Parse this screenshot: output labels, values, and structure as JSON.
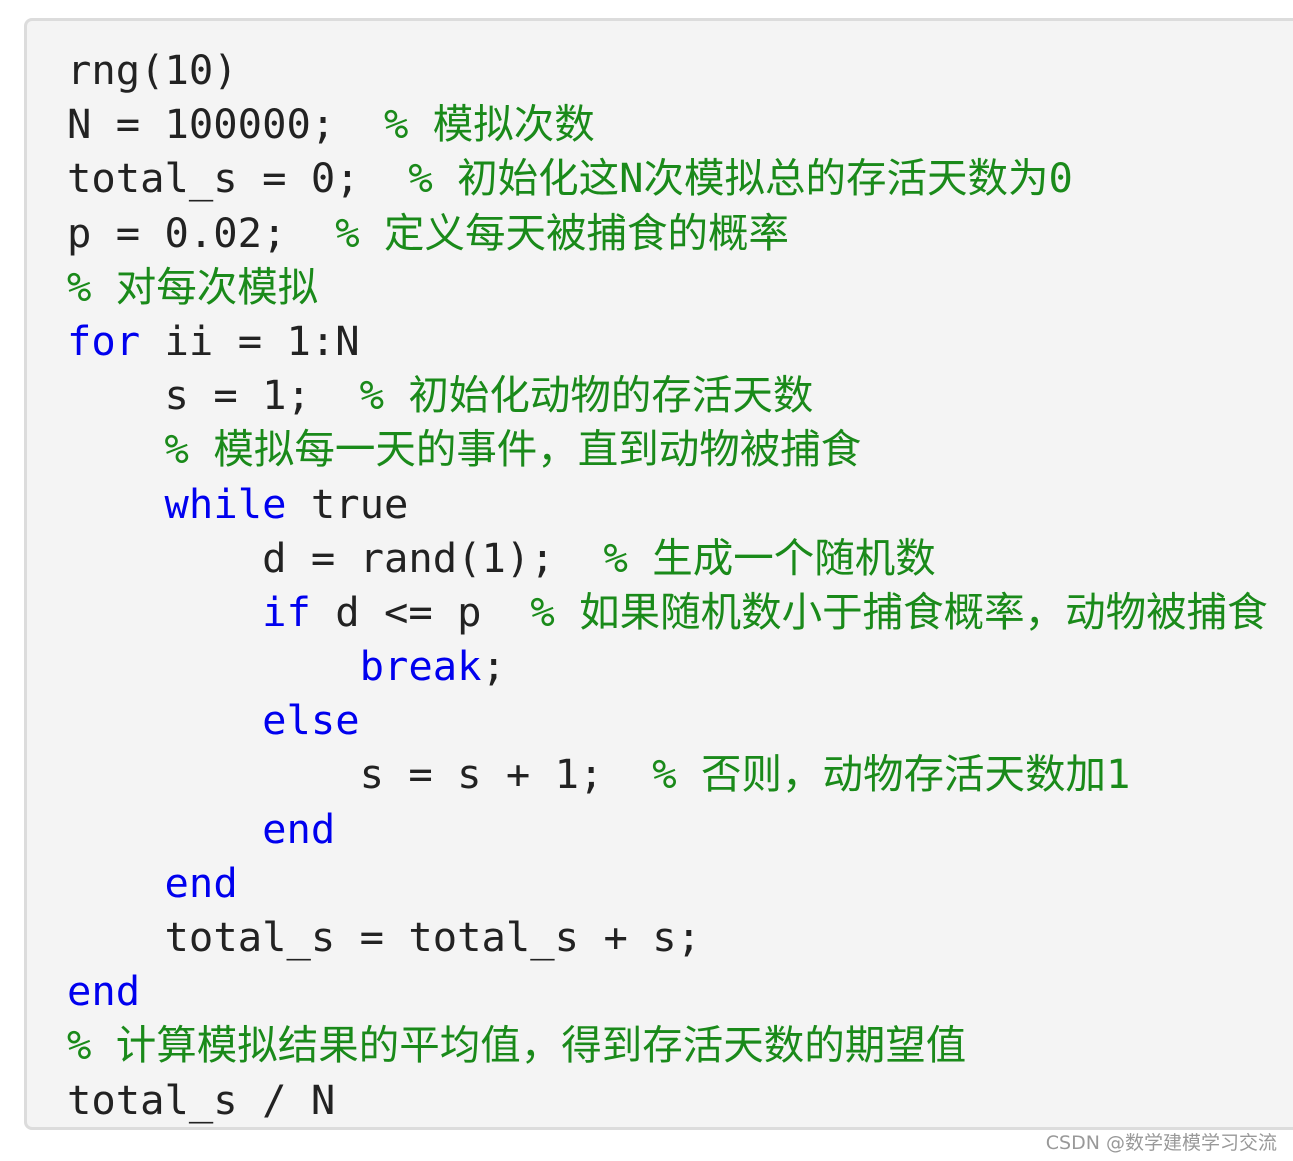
{
  "code_lines": [
    {
      "indent": "",
      "parts": [
        {
          "t": "code",
          "v": "rng(10)"
        }
      ]
    },
    {
      "indent": "",
      "parts": [
        {
          "t": "code",
          "v": "N = 100000;  "
        },
        {
          "t": "comment",
          "v": "% 模拟次数"
        }
      ]
    },
    {
      "indent": "",
      "parts": [
        {
          "t": "code",
          "v": "total_s = 0;  "
        },
        {
          "t": "comment",
          "v": "% 初始化这N次模拟总的存活天数为0"
        }
      ]
    },
    {
      "indent": "",
      "parts": [
        {
          "t": "code",
          "v": "p = 0.02;  "
        },
        {
          "t": "comment",
          "v": "% 定义每天被捕食的概率"
        }
      ]
    },
    {
      "indent": "",
      "parts": [
        {
          "t": "comment",
          "v": "% 对每次模拟"
        }
      ]
    },
    {
      "indent": "",
      "parts": [
        {
          "t": "keyword",
          "v": "for"
        },
        {
          "t": "code",
          "v": " ii = 1:N"
        }
      ]
    },
    {
      "indent": "    ",
      "parts": [
        {
          "t": "code",
          "v": "s = 1;  "
        },
        {
          "t": "comment",
          "v": "% 初始化动物的存活天数"
        }
      ]
    },
    {
      "indent": "    ",
      "parts": [
        {
          "t": "comment",
          "v": "% 模拟每一天的事件，直到动物被捕食"
        }
      ]
    },
    {
      "indent": "    ",
      "parts": [
        {
          "t": "keyword",
          "v": "while"
        },
        {
          "t": "code",
          "v": " true"
        }
      ]
    },
    {
      "indent": "        ",
      "parts": [
        {
          "t": "code",
          "v": "d = rand(1);  "
        },
        {
          "t": "comment",
          "v": "% 生成一个随机数"
        }
      ]
    },
    {
      "indent": "        ",
      "parts": [
        {
          "t": "keyword",
          "v": "if"
        },
        {
          "t": "code",
          "v": " d <= p  "
        },
        {
          "t": "comment",
          "v": "% 如果随机数小于捕食概率，动物被捕食"
        }
      ]
    },
    {
      "indent": "            ",
      "parts": [
        {
          "t": "keyword",
          "v": "break"
        },
        {
          "t": "code",
          "v": ";"
        }
      ]
    },
    {
      "indent": "        ",
      "parts": [
        {
          "t": "keyword",
          "v": "else"
        }
      ]
    },
    {
      "indent": "            ",
      "parts": [
        {
          "t": "code",
          "v": "s = s + 1;  "
        },
        {
          "t": "comment",
          "v": "% 否则，动物存活天数加1"
        }
      ]
    },
    {
      "indent": "        ",
      "parts": [
        {
          "t": "keyword",
          "v": "end"
        }
      ]
    },
    {
      "indent": "    ",
      "parts": [
        {
          "t": "keyword",
          "v": "end"
        }
      ]
    },
    {
      "indent": "    ",
      "parts": [
        {
          "t": "code",
          "v": "total_s = total_s + s;"
        }
      ]
    },
    {
      "indent": "",
      "parts": [
        {
          "t": "keyword",
          "v": "end"
        }
      ]
    },
    {
      "indent": "",
      "parts": [
        {
          "t": "comment",
          "v": "% 计算模拟结果的平均值，得到存活天数的期望值"
        }
      ]
    },
    {
      "indent": "",
      "parts": [
        {
          "t": "code",
          "v": "total_s / N"
        }
      ]
    }
  ],
  "colors": {
    "keyword": "#0000ee",
    "comment": "#1a8a1a",
    "code": "#222222"
  },
  "watermark": "CSDN @数学建模学习交流"
}
